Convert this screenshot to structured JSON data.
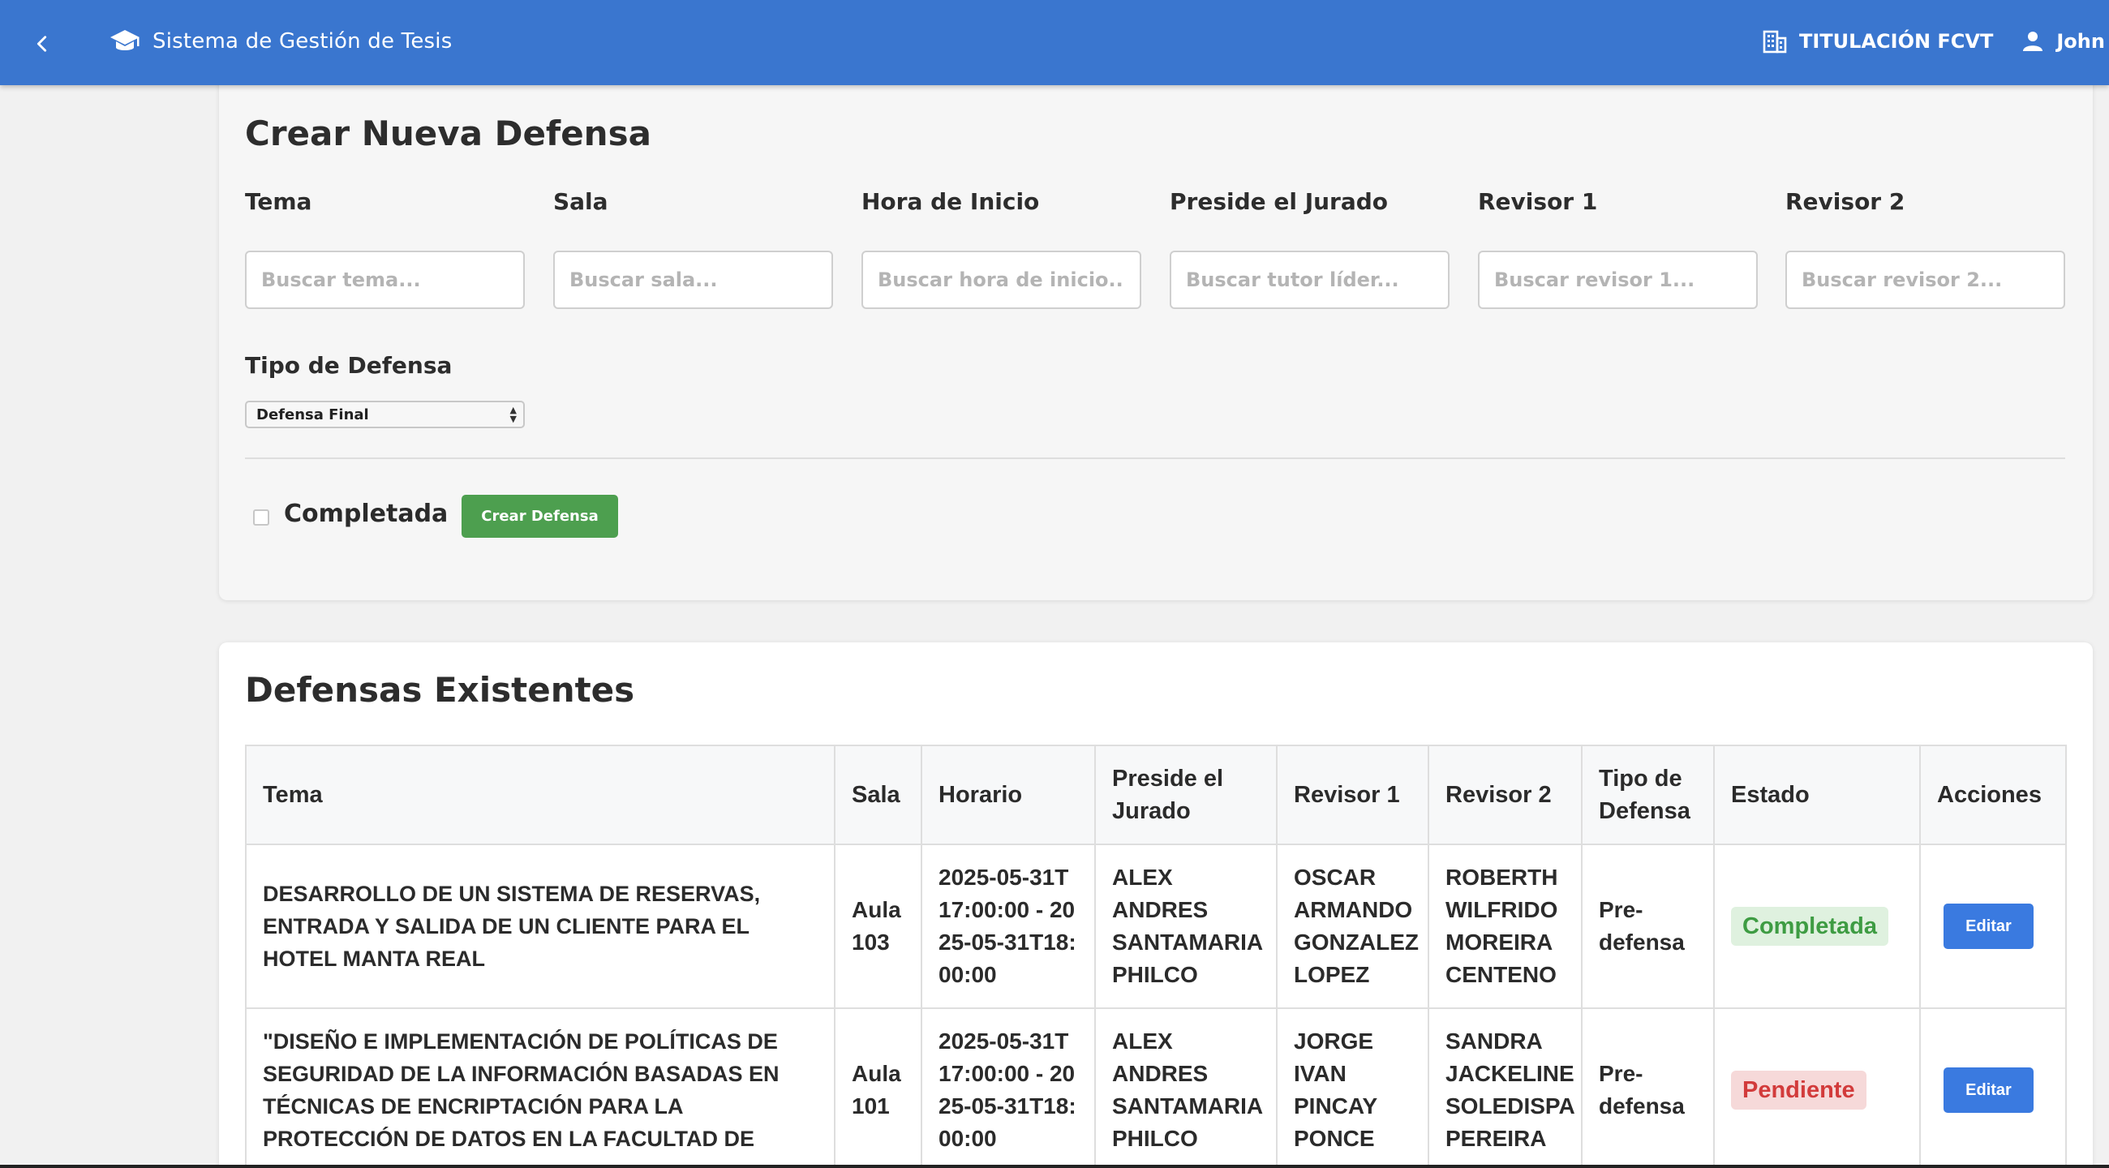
{
  "app": {
    "title": "Sistema de Gestión de Tesis",
    "faculty": "TITULACIÓN FCVT",
    "user": "John C."
  },
  "icons": {
    "back": "chevron-left-icon",
    "brand": "graduation-cap-icon",
    "faculty": "building-icon",
    "user": "person-icon"
  },
  "colors": {
    "topbar": "#3a76cf",
    "create_button": "#4d9f4f",
    "edit_button": "#3a7ae0",
    "status_completed": "#3e9c43",
    "status_pending": "#d23b3b"
  },
  "create_form": {
    "title": "Crear Nueva Defensa",
    "fields": [
      {
        "label": "Tema",
        "placeholder": "Buscar tema..."
      },
      {
        "label": "Sala",
        "placeholder": "Buscar sala..."
      },
      {
        "label": "Hora de Inicio",
        "placeholder": "Buscar hora de inicio..."
      },
      {
        "label": "Preside el Jurado",
        "placeholder": "Buscar tutor líder..."
      },
      {
        "label": "Revisor 1",
        "placeholder": "Buscar revisor 1..."
      },
      {
        "label": "Revisor 2",
        "placeholder": "Buscar revisor 2..."
      }
    ],
    "defense_type_label": "Tipo de Defensa",
    "defense_type_selected": "Defensa Final",
    "completed_label": "Completada",
    "completed_checked": false,
    "submit_label": "Crear Defensa"
  },
  "list": {
    "title": "Defensas Existentes",
    "columns": [
      "Tema",
      "Sala",
      "Horario",
      "Preside el Jurado",
      "Revisor 1",
      "Revisor 2",
      "Tipo de Defensa",
      "Estado",
      "Acciones"
    ],
    "rows": [
      {
        "tema": "DESARROLLO DE UN SISTEMA DE RESERVAS, ENTRADA Y SALIDA DE UN CLIENTE PARA EL HOTEL MANTA REAL",
        "sala": "Aula 103",
        "horario": "2025-05-31T17:00:00 - 2025-05-31T18:00:00",
        "preside": "ALEX ANDRES SANTAMARIA PHILCO",
        "revisor1": "OSCAR ARMANDO GONZALEZ LOPEZ",
        "revisor2": "ROBERTH WILFRIDO MOREIRA CENTENO",
        "tipo": "Pre-defensa",
        "estado": "Completada",
        "accion": "Editar"
      },
      {
        "tema": "\"DISEÑO E IMPLEMENTACIÓN DE POLÍTICAS DE SEGURIDAD DE LA INFORMACIÓN BASADAS EN TÉCNICAS DE ENCRIPTACIÓN PARA LA PROTECCIÓN DE DATOS EN LA FACULTAD DE",
        "sala": "Aula 101",
        "horario": "2025-05-31T17:00:00 - 2025-05-31T18:00:00",
        "preside": "ALEX ANDRES SANTAMARIA PHILCO",
        "revisor1": "JORGE IVAN PINCAY PONCE",
        "revisor2": "SANDRA JACKELINE SOLEDISPA PEREIRA",
        "tipo": "Pre-defensa",
        "estado": "Pendiente",
        "accion": "Editar"
      }
    ]
  }
}
